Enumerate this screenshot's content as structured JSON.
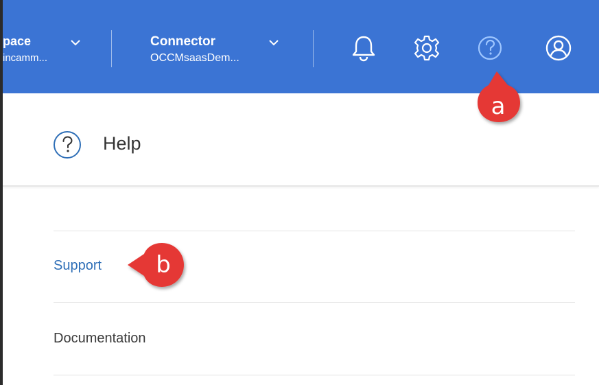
{
  "header": {
    "workspace": {
      "title": "pace",
      "subtitle": "incamm..."
    },
    "connector": {
      "title": "Connector",
      "subtitle": "OCCMsaasDem..."
    },
    "icons": {
      "notifications": "bell-icon",
      "settings": "gear-icon",
      "help": "help-circle-icon",
      "account": "user-circle-icon"
    },
    "colors": {
      "bar": "#3b74d4",
      "highlight_icon": "#9ec6ff"
    }
  },
  "panel": {
    "title": "Help",
    "items": [
      {
        "label": "Support"
      },
      {
        "label": "Documentation"
      }
    ],
    "colors": {
      "link": "#2f6fb7"
    }
  },
  "callouts": {
    "a": "a",
    "b": "b",
    "color": "#e53935"
  }
}
